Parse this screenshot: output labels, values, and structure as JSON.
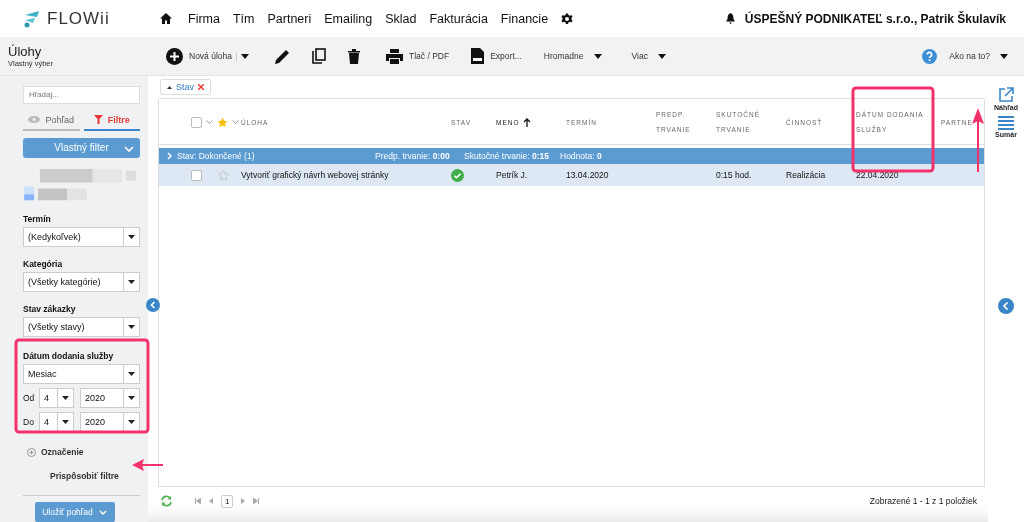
{
  "brand": "FLOWii",
  "nav": [
    {
      "label": "Firma"
    },
    {
      "label": "Tím"
    },
    {
      "label": "Partneri"
    },
    {
      "label": "Emailing"
    },
    {
      "label": "Sklad"
    },
    {
      "label": "Fakturácia"
    },
    {
      "label": "Financie"
    }
  ],
  "account": "ÚSPEŠNÝ PODNIKATEĽ s.r.o., Patrik Škulavík",
  "page": {
    "title": "Úlohy",
    "subtitle": "Vlastný výber"
  },
  "toolbar": {
    "new": "Nová úloha",
    "print": "Tlač / PDF",
    "export": "Export...",
    "bulk": "Hromadne",
    "more": "Viac",
    "help": "Ako na to?"
  },
  "sidebar": {
    "search_placeholder": "Hľadaj...",
    "view_tabs": [
      {
        "label": "Pohľad",
        "selected": false
      },
      {
        "label": "Filtre",
        "selected": true
      }
    ],
    "custom_filter": "Vlastný filter",
    "filters": [
      {
        "label": "Termín",
        "value": "(Kedykoľvek)"
      },
      {
        "label": "Kategória",
        "value": "(Všetky kategórie)"
      },
      {
        "label": "Stav zákazky",
        "value": "(Všetky stavy)"
      }
    ],
    "date_filter": {
      "label": "Dátum dodania služby",
      "period": "Mesiac",
      "from_label": "Od",
      "from_month": "4",
      "from_year": "2020",
      "to_label": "Do",
      "to_month": "4",
      "to_year": "2020"
    },
    "marking": "Označenie",
    "customize": "Prispôsobiť filtre",
    "save": "Uložiť pohľad"
  },
  "group_chip": "Stav",
  "table": {
    "select_all_checked": false,
    "columns": [
      {
        "label": "ÚLOHA",
        "sorted": false
      },
      {
        "label": "STAV",
        "sorted": false
      },
      {
        "label": "MENO",
        "sorted": true
      },
      {
        "label": "TERMÍN",
        "sorted": false
      },
      {
        "label": "PREDP. TRVANIE",
        "sorted": false
      },
      {
        "label": "SKUTOČNÉ TRVANIE",
        "sorted": false
      },
      {
        "label": "ČINNOSŤ",
        "sorted": false
      },
      {
        "label": "DÁTUM DODANIA SLUŽBY",
        "sorted": false
      },
      {
        "label": "PARTNE",
        "sorted": false
      }
    ],
    "group": {
      "label": "Stav: Dokončené (1)",
      "stats": [
        "Predp. trvanie: **0:00**",
        "Skutočné trvanie: **0:15**",
        "Hodnota: **0**"
      ]
    },
    "rows": [
      {
        "checked": false,
        "starred": false,
        "task": "Vytvoriť grafický návrh webovej stránky",
        "done": true,
        "name": "Petrík J.",
        "deadline": "13.04.2020",
        "actual": "0:15 hod.",
        "activity": "Realizácia",
        "delivery_date": "22.04.2020"
      }
    ]
  },
  "side_actions": [
    {
      "label": "Náhľad"
    },
    {
      "label": "Sumár"
    }
  ],
  "pager": {
    "page": "1",
    "summary": "Zobrazené 1 - 1 z 1 položiek"
  }
}
